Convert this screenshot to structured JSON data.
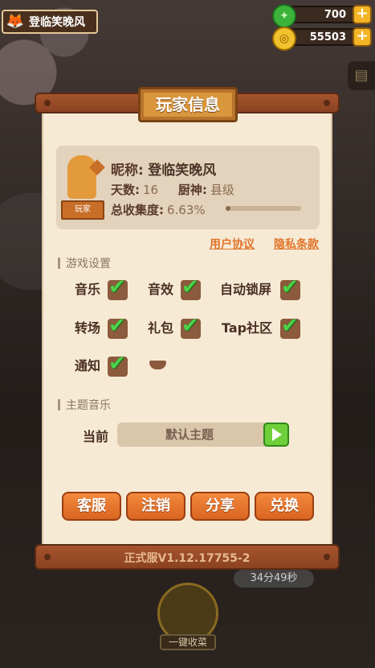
{
  "topbar": {
    "player_name": "登临笑晚风",
    "jade": "700",
    "coins": "55503",
    "plus": "+"
  },
  "panel": {
    "title": "玩家信息",
    "profile": {
      "nickname_label": "昵称:",
      "nickname": "登临笑晚风",
      "days_label": "天数:",
      "days": "16",
      "chef_label": "厨神:",
      "chef": "县级",
      "collection_label": "总收集度:",
      "collection": "6.63%",
      "collection_fraction": 0.0663,
      "badge": "玩家"
    },
    "links": {
      "user_agreement": "用户协议",
      "privacy": "隐私条款"
    },
    "game_settings": {
      "heading": "游戏设置",
      "options": [
        {
          "label": "音乐",
          "checked": true
        },
        {
          "label": "音效",
          "checked": true
        },
        {
          "label": "自动锁屏",
          "checked": true
        },
        {
          "label": "转场",
          "checked": true
        },
        {
          "label": "礼包",
          "checked": true
        },
        {
          "label": "Tap社区",
          "checked": true
        },
        {
          "label": "通知",
          "checked": true
        },
        {
          "label": "",
          "checked": false
        }
      ]
    },
    "theme_music": {
      "heading": "主题音乐",
      "current_label": "当前",
      "current_value": "默认主题"
    },
    "buttons": {
      "service": "客服",
      "logout": "注销",
      "share": "分享",
      "redeem": "兑换"
    },
    "version": "正式服V1.12.17755-2"
  },
  "background": {
    "timer": "34分49秒",
    "collect_all": "一键收菜"
  }
}
